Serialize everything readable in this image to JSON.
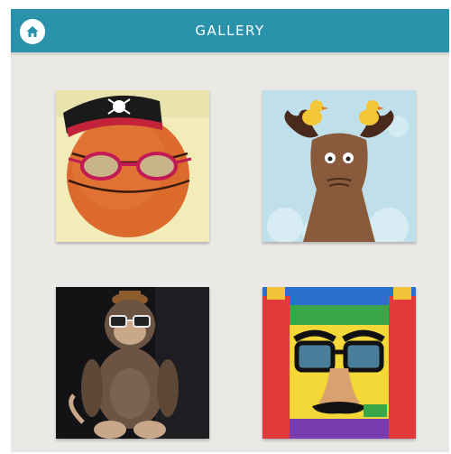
{
  "header": {
    "title": "GALLERY",
    "home_icon": "home-icon"
  },
  "colors": {
    "header_bg": "#2a93ab",
    "page_bg": "#ebe9e6"
  },
  "gallery": {
    "items": [
      {
        "subject": "basketball-pirate"
      },
      {
        "subject": "moose-with-birds"
      },
      {
        "subject": "monkey-plush-glasses"
      },
      {
        "subject": "bounce-house-disguise"
      }
    ]
  }
}
